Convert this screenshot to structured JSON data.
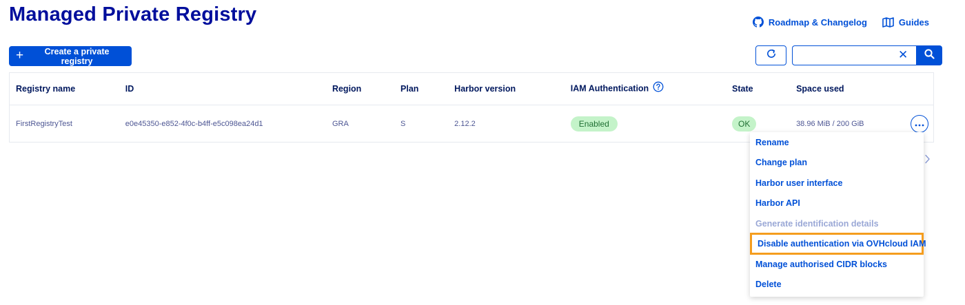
{
  "page": {
    "title": "Managed Private Registry"
  },
  "top_links": [
    {
      "label": "Roadmap & Changelog",
      "icon": "github-icon"
    },
    {
      "label": "Guides",
      "icon": "book-icon"
    }
  ],
  "toolbar": {
    "create_label": "Create a private registry",
    "search_value": "",
    "search_placeholder": ""
  },
  "table": {
    "columns": [
      "Registry name",
      "ID",
      "Region",
      "Plan",
      "Harbor version",
      "IAM Authentication",
      "State",
      "Space used"
    ],
    "rows": [
      {
        "name": "FirstRegistryTest",
        "id": "e0e45350-e852-4f0c-b4ff-e5c098ea24d1",
        "region": "GRA",
        "plan": "S",
        "harbor_version": "2.12.2",
        "iam_authentication": "Enabled",
        "state": "OK",
        "space_used": "38.96 MiB / 200 GiB"
      }
    ]
  },
  "actions_menu": {
    "items": [
      {
        "label": "Rename",
        "enabled": true
      },
      {
        "label": "Change plan",
        "enabled": true
      },
      {
        "label": "Harbor user interface",
        "enabled": true
      },
      {
        "label": "Harbor API",
        "enabled": true
      },
      {
        "label": "Generate identification details",
        "enabled": false
      },
      {
        "label": "Disable authentication via OVHcloud IAM",
        "enabled": true,
        "highlighted": true
      },
      {
        "label": "Manage authorised CIDR blocks",
        "enabled": true
      },
      {
        "label": "Delete",
        "enabled": true
      }
    ]
  },
  "colors": {
    "primary": "#0050d7",
    "title": "#000e9c",
    "badge_bg": "#c4f3c9",
    "highlight_border": "#f59d1e"
  }
}
